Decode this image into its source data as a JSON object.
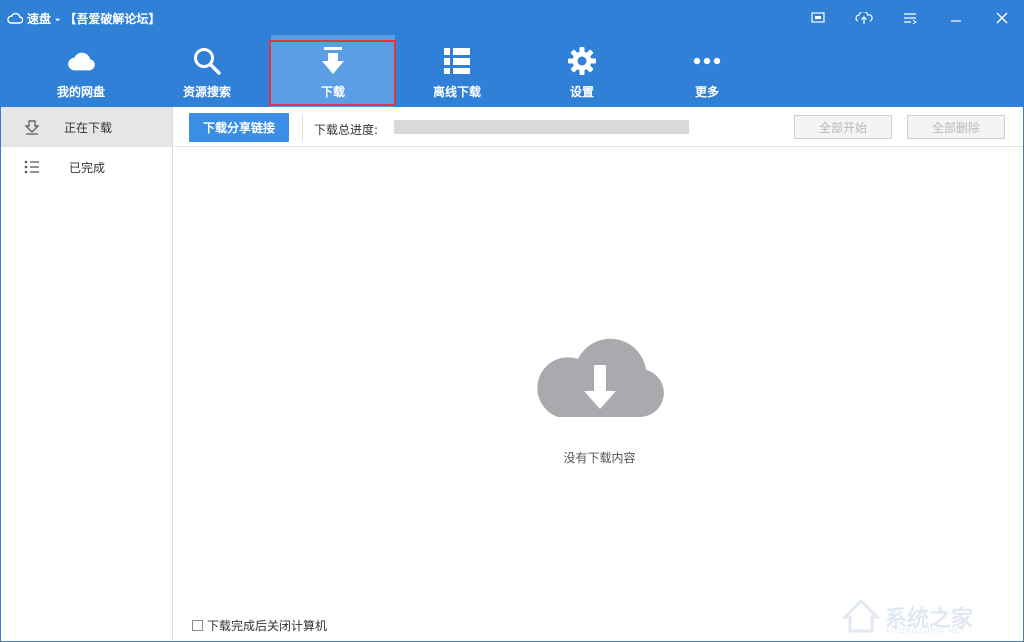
{
  "window": {
    "title": "速盘 - 【吾爱破解论坛】",
    "controls": [
      "skin-icon",
      "upload-icon",
      "menu-icon",
      "minimize-icon",
      "close-icon"
    ]
  },
  "nav": {
    "items": [
      {
        "label": "我的网盘",
        "icon": "cloud-icon"
      },
      {
        "label": "资源搜索",
        "icon": "search-icon"
      },
      {
        "label": "下载",
        "icon": "download-icon",
        "active": true
      },
      {
        "label": "离线下载",
        "icon": "list-icon"
      },
      {
        "label": "设置",
        "icon": "gear-icon"
      },
      {
        "label": "更多",
        "icon": "more-icon"
      }
    ]
  },
  "sidebar": {
    "items": [
      {
        "label": "正在下载",
        "icon": "download-arrow-icon",
        "active": true
      },
      {
        "label": "已完成",
        "icon": "list-bullets-icon"
      }
    ]
  },
  "toolbar": {
    "share_link_button": "下载分享链接",
    "progress_label": "下载总进度:",
    "progress_value": 0,
    "start_all": "全部开始",
    "delete_all": "全部删除"
  },
  "main": {
    "empty_text": "没有下载内容"
  },
  "footer": {
    "shutdown_label": "下载完成后关闭计算机",
    "shutdown_checked": false
  },
  "watermark": {
    "text": "系统之家",
    "sub": "XITONGZHIJIA.NET"
  },
  "colors": {
    "header_blue": "#2f80d6",
    "active_tab": "#5b9ee6",
    "highlight_red": "#e0373f",
    "primary_button": "#3a8ee6"
  }
}
